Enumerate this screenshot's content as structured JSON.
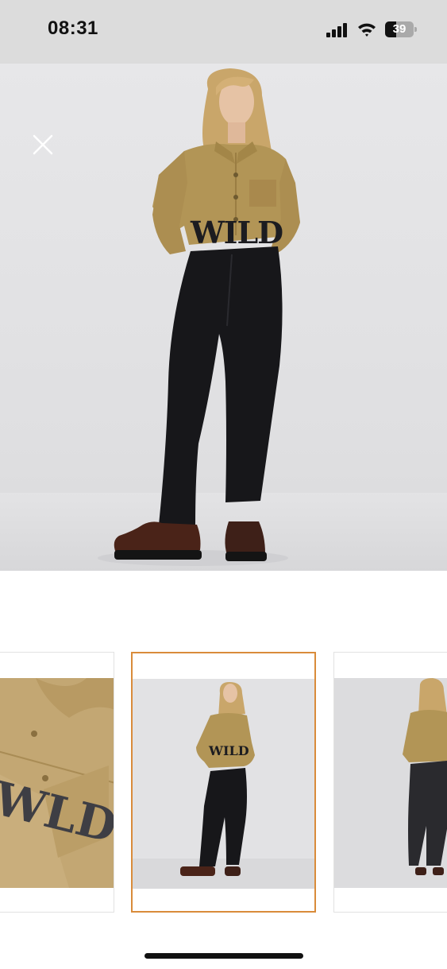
{
  "status_bar": {
    "time": "08:31",
    "battery_level": "39",
    "battery_fraction": 0.39,
    "icons": [
      "signal-icon",
      "wifi-icon",
      "battery-icon"
    ]
  },
  "viewer": {
    "close_icon": "close-icon",
    "main_image": "model-wearing-cropped-khaki-shirt-and-black-jeans",
    "shirt_print": "WILD",
    "thumbnails": [
      {
        "image": "shirt-closeup",
        "print_text": "WLD",
        "selected": false
      },
      {
        "image": "model-front",
        "print_text": "WILD",
        "selected": true
      },
      {
        "image": "model-back",
        "selected": false
      }
    ],
    "selected_index": 1
  },
  "colors": {
    "accent": "#d98b3a",
    "status_bar_bg": "#dcdcdc",
    "shirt": "#b29556",
    "jeans": "#17171a",
    "background": "#e4e4e6"
  }
}
